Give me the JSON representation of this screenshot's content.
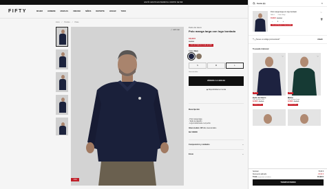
{
  "promo_bar": "ENVÍO GRATIS EN PEDIDOS A PARTIR DE 50€",
  "header": {
    "logo": "FIFTY",
    "nav": [
      "MUJER",
      "HOMBRE",
      "MARCAS",
      "VERANO",
      "NIÑOS",
      "DEPORTE",
      "HOGAR",
      "TODO"
    ]
  },
  "breadcrumb": [
    "Inicio",
    "Hombre",
    "Polos"
  ],
  "gallery": {
    "zoom_label": "AMPLIAR",
    "discount_badge": "-70%"
  },
  "product": {
    "brand": "Pedro del Hierro",
    "name": "Polo manga larga con logo bordado",
    "price_now": "16,99 €",
    "price_old": "79,95 €",
    "promo": "-20% EXTRA EN TODA LA WEB",
    "color_label": "Color:",
    "color_value": "Navy",
    "swatches": [
      "#1d2240",
      "#8a7866"
    ],
    "sizes": [
      "S",
      "M",
      "L"
    ],
    "size_guide": "Guía de tallas",
    "add_button": "AÑADIR A LA BOLSA",
    "availability": "Disponibilidad en tienda",
    "description_title": "Descripción",
    "description_items": [
      "Polo manga larga",
      "Tejido de algodón",
      "Logo institucional en el pecho"
    ],
    "model_info": "Altura modelo: 187 cm.",
    "model_size": "Lleva la talla L",
    "ref": "Ref: 000000",
    "accordion": [
      "Composición y cuidados",
      "Envío"
    ]
  },
  "cart": {
    "title": "Cesta (1)",
    "item": {
      "name": "Polo manga larga con logo bordado",
      "size": "Talla: L",
      "color": "Color: Navy",
      "price_now": "16,99 €",
      "price_old": "79,95 €",
      "qty": "1",
      "promo": "-20% EXTRA EN TODA LA WEB"
    },
    "coupon": "¿Tienes un código promocional?",
    "coupon_action": "Añadir",
    "reco_title": "Te puede interesar",
    "recos": [
      {
        "brand": "Pedro del Hierro",
        "name": "Polo manga corta",
        "price_now": "12,99 €",
        "price_old": "39,95 €",
        "badge": "-67%",
        "pill": "Precio 10,39 €",
        "shirt": "#1d2240"
      },
      {
        "brand": "Milano",
        "name": "Polo manga larga",
        "price_now": "12,99 €",
        "price_old": "39,95 €",
        "badge": "-67%",
        "pill": "Precio 10,39 €",
        "shirt": "#163a34"
      }
    ],
    "totals": {
      "subtotal_label": "Subtotal",
      "subtotal_value": "79,95 €",
      "discount_label": "Descuento aplicado",
      "discount_value": "-63,96 €",
      "total_label": "Total",
      "total_sub": "(impuestos incluidos)",
      "total_value": "16,99 €"
    },
    "checkout": "TRAMITAR PEDIDO"
  }
}
